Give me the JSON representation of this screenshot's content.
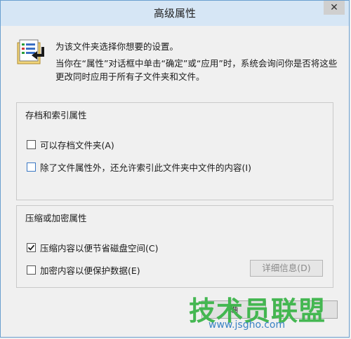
{
  "window": {
    "title": "高级属性",
    "close_glyph": "✕"
  },
  "info": {
    "line1": "为该文件夹选择你想要的设置。",
    "line2": "当你在“属性”对话框中单击“确定”或“应用”时，系统会询问你是否将这些更改同时应用于所有子文件夹和文件。"
  },
  "archive_group": {
    "title": "存档和索引属性",
    "options": [
      {
        "label": "可以存档文件夹(A)",
        "checked": false
      },
      {
        "label": "除了文件属性外，还允许索引此文件夹中文件的内容(I)",
        "checked": false
      }
    ]
  },
  "compress_group": {
    "title": "压缩或加密属性",
    "options": [
      {
        "label": "压缩内容以便节省磁盘空间(C)",
        "checked": true
      },
      {
        "label": "加密内容以便保护数据(E)",
        "checked": false
      }
    ],
    "details_label": "详细信息(D)"
  },
  "buttons": {
    "ok_label": "确"
  },
  "watermark": {
    "text": "技术员联盟",
    "url": "www.jsgho.com"
  },
  "colors": {
    "accent": "#6a9fcf",
    "watermark_green": "#3cb54a",
    "watermark_blue": "#3a82c4"
  }
}
